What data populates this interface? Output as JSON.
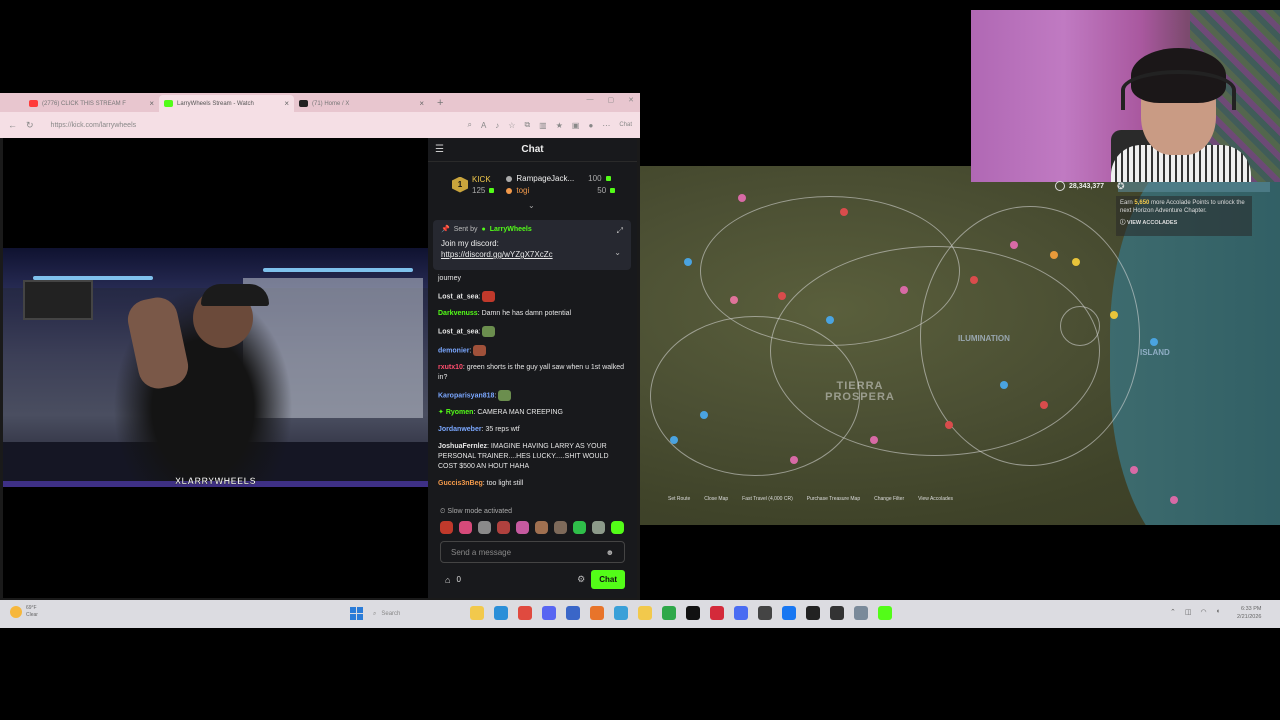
{
  "browser": {
    "tabs": [
      {
        "label": "(2776) CLICK THIS STREAM F",
        "icon_color": "#ff3b3b"
      },
      {
        "label": "LarryWheels Stream - Watch",
        "icon_color": "#53fc18"
      },
      {
        "label": "(71) Home / X",
        "icon_color": "#222222"
      }
    ],
    "new_tab": "+",
    "url": "https://kick.com/larrywheels",
    "chat_button": "Chat"
  },
  "video": {
    "watermark": "XLARRYWHEELS"
  },
  "chat": {
    "title": "Chat",
    "leaderboard": {
      "rank": "1",
      "first_name": "KICK",
      "first_points": "125",
      "second_name": "RampageJack...",
      "second_points": "100",
      "third_name": "togi",
      "third_points": "50"
    },
    "pinned": {
      "sent_by_label": "Sent by",
      "sender": "LarryWheels",
      "text": "Join my discord:",
      "link": "https://discord.gg/wYZgX7XcZc"
    },
    "partial_top": "journey",
    "messages": [
      {
        "user": "Lost_at_sea",
        "color": "#e6e6e6",
        "text": ":",
        "emote": "#c0392b"
      },
      {
        "user": "Darkvenuss",
        "color": "#53fc18",
        "text": ": Damn he has damn potential",
        "emote": ""
      },
      {
        "user": "Lost_at_sea",
        "color": "#e6e6e6",
        "text": ":",
        "emote": "#6b8e4e"
      },
      {
        "user": "demonier",
        "color": "#7aa7ff",
        "text": ":",
        "emote": "#a0513a"
      },
      {
        "user": "rxutx10",
        "color": "#ff4d6d",
        "text": ": green shorts is the guy yall saw when u 1st walked in?",
        "emote": ""
      },
      {
        "user": "Karoparisyan818",
        "color": "#7aa7ff",
        "text": ":",
        "emote": "#6b8e4e"
      },
      {
        "user": "Ryomen",
        "color": "#53fc18",
        "text": ": CAMERA MAN CREEPING",
        "emote": ""
      },
      {
        "user": "Jordanweber",
        "color": "#7aa7ff",
        "text": ": 35 reps wtf",
        "emote": ""
      },
      {
        "user": "JoshuaFernlez",
        "color": "#e6e6e6",
        "text": ": IMAGINE HAVING LARRY AS YOUR PERSONAL TRAINER....HES LUCKY.....SHIT WOULD COST $500 AN HOUT HAHA",
        "emote": ""
      },
      {
        "user": "Guccis3nBeg",
        "color": "#f2994a",
        "text": ": too light still",
        "emote": ""
      }
    ],
    "slow_mode": "Slow mode activated",
    "input_placeholder": "Send a message",
    "store_count": "0",
    "send_label": "Chat"
  },
  "map": {
    "label_main": "TIERRA PROSPERA",
    "label_region": "ILUMINATION",
    "label_island": "ISLAND",
    "legend": [
      "Set Route",
      "Close Map",
      "Fast Travel (4,000 CR)",
      "Purchase Treasure Map",
      "Change Filter",
      "View Accolades"
    ]
  },
  "hud": {
    "credits": "28,343,377",
    "accolade_prefix": "Earn",
    "accolade_points": "5,650",
    "accolade_suffix": "more Accolade Points to unlock the next Horizon Adventure Chapter.",
    "view_accolades": "VIEW ACCOLADES"
  },
  "taskbar": {
    "weather_temp": "69°F",
    "weather_desc": "Clear",
    "search": "Search",
    "time": "6:33 PM",
    "date": "2/21/2026"
  }
}
